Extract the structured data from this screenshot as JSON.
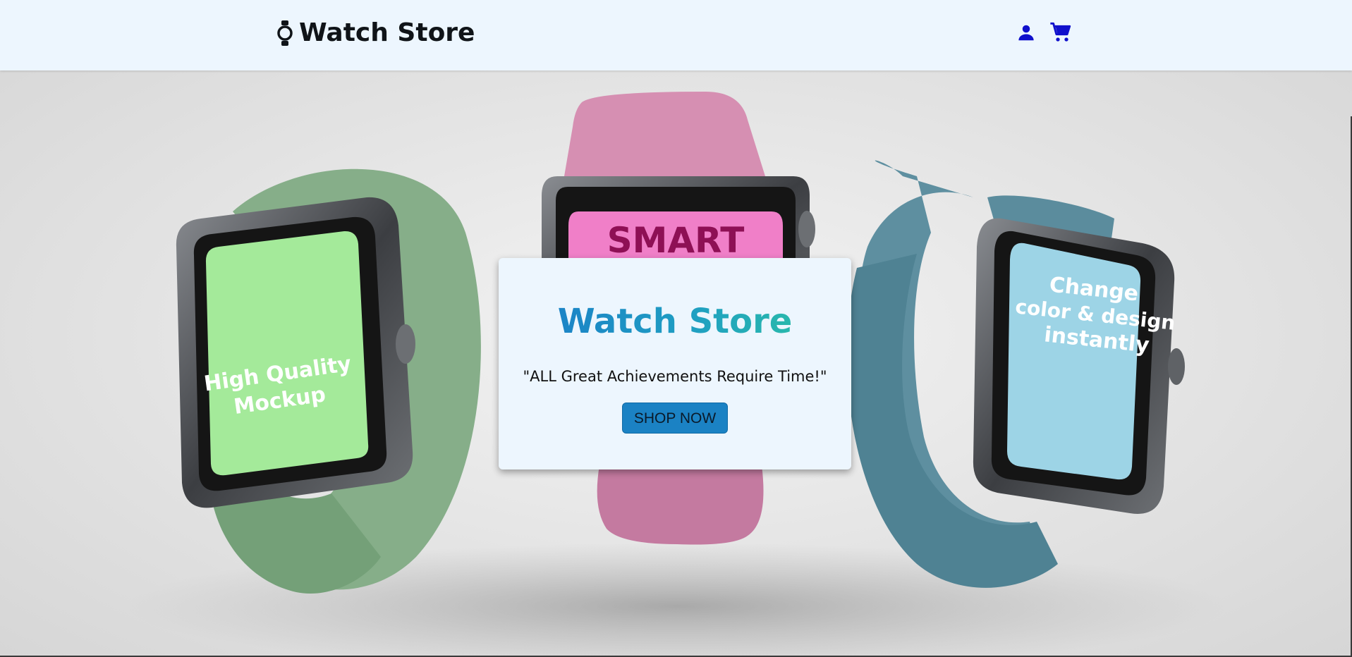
{
  "header": {
    "brand": "Watch Store",
    "brand_icon": "watch-icon",
    "icons": [
      "user-icon",
      "cart-icon"
    ],
    "icon_color": "#1010cc"
  },
  "hero": {
    "watches": [
      {
        "screen_text": [
          "High Quality",
          "Mockup"
        ],
        "band_color": "#7fa883",
        "screen_color": "#a4ea9a"
      },
      {
        "screen_text": [
          "SMART"
        ],
        "band_color": "#d48bb0",
        "screen_color": "#f07fc8"
      },
      {
        "screen_text": [
          "Change",
          "color & design",
          "instantly"
        ],
        "band_color": "#5e8fa0",
        "screen_color": "#9dd4e6"
      }
    ]
  },
  "card": {
    "title": "Watch Store",
    "quote": "\"ALL Great Achievements Require Time!\"",
    "button_label": "SHOP NOW",
    "title_gradient": [
      "#1a78c8",
      "#2ec6a0"
    ],
    "button_color": "#1b82c4"
  }
}
